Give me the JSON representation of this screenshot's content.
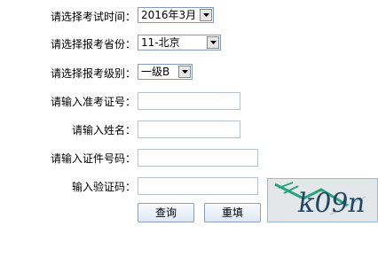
{
  "form": {
    "exam_time": {
      "label": "请选择考试时间：",
      "value": "2016年3月"
    },
    "province": {
      "label": "请选择报考省份：",
      "value": "11-北京"
    },
    "level": {
      "label": "请选择报考级别：",
      "value": "一级B"
    },
    "admission_no": {
      "label": "请输入准考证号：",
      "value": ""
    },
    "name": {
      "label": "请输入姓名：",
      "value": ""
    },
    "id_no": {
      "label": "请输入证件号码：",
      "value": ""
    },
    "captcha": {
      "label": "输入验证码：",
      "value": "",
      "image_text": "k09n"
    }
  },
  "buttons": {
    "query": "查询",
    "reset": "重填"
  },
  "colors": {
    "captcha_text": "#1f4766",
    "captcha_line": "#2aa37a"
  }
}
